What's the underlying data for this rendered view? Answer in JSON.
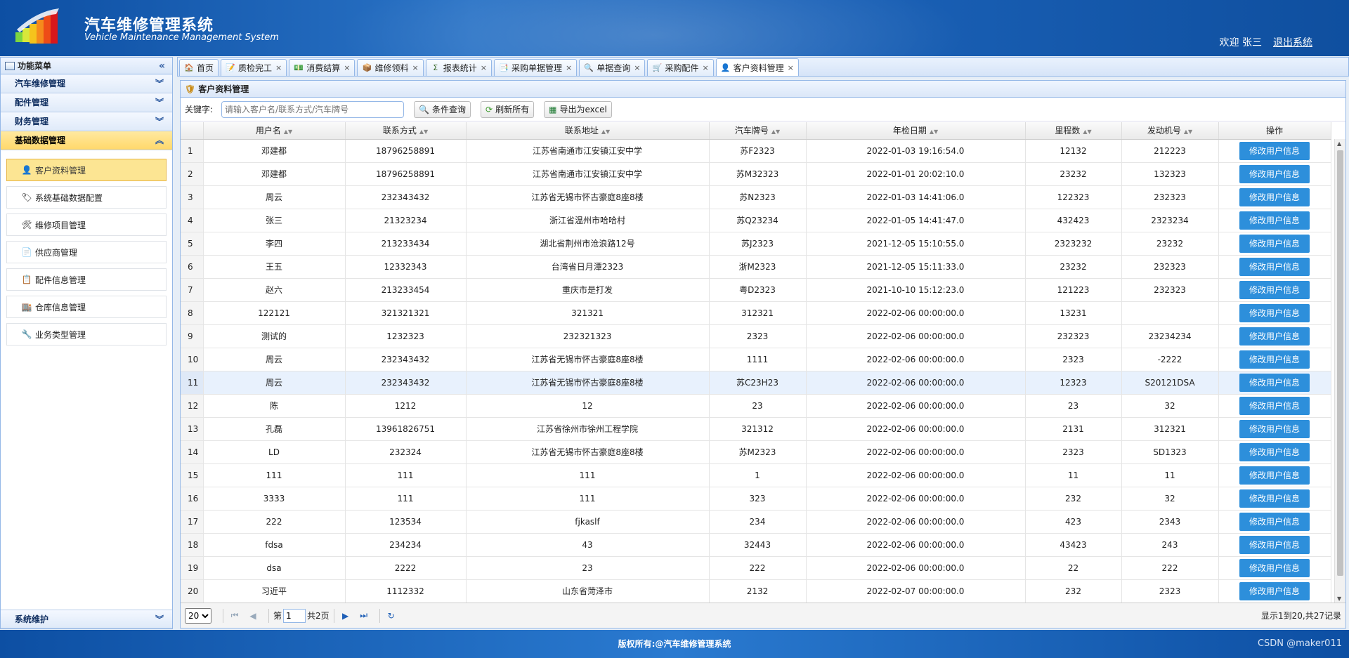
{
  "header": {
    "title": "汽车维修管理系统",
    "subtitle": "Vehicle Maintenance Management System",
    "welcome": "欢迎 张三",
    "logout": "退出系统"
  },
  "sidebar": {
    "title": "功能菜单",
    "sections": [
      {
        "label": "汽车维修管理"
      },
      {
        "label": "配件管理"
      },
      {
        "label": "财务管理"
      },
      {
        "label": "基础数据管理"
      }
    ],
    "items": [
      {
        "label": "客户资料管理",
        "icon": "user-icon"
      },
      {
        "label": "系统基础数据配置",
        "icon": "tag-icon"
      },
      {
        "label": "维修项目管理",
        "icon": "repair-icon"
      },
      {
        "label": "供应商管理",
        "icon": "document-icon"
      },
      {
        "label": "配件信息管理",
        "icon": "parts-icon"
      },
      {
        "label": "仓库信息管理",
        "icon": "warehouse-icon"
      },
      {
        "label": "业务类型管理",
        "icon": "wrench-icon"
      }
    ],
    "bottom_section": "系统维护"
  },
  "tabs": [
    {
      "label": "首页"
    },
    {
      "label": "质检完工"
    },
    {
      "label": "消费结算"
    },
    {
      "label": "维修领料"
    },
    {
      "label": "报表统计"
    },
    {
      "label": "采购单据管理"
    },
    {
      "label": "单据查询"
    },
    {
      "label": "采购配件"
    },
    {
      "label": "客户资料管理"
    }
  ],
  "panel": {
    "title": "客户资料管理",
    "keyword_label": "关键字:",
    "search_placeholder": "请输入客户名/联系方式/汽车牌号",
    "btn_query": "条件查询",
    "btn_refresh": "刷新所有",
    "btn_export": "导出为excel"
  },
  "table": {
    "columns": [
      "用户名",
      "联系方式",
      "联系地址",
      "汽车牌号",
      "年检日期",
      "里程数",
      "发动机号",
      "操作"
    ],
    "action_label": "修改用户信息",
    "rows": [
      [
        "1",
        "邓建都",
        "18796258891",
        "江苏省南通市江安镇江安中学",
        "苏F2323",
        "2022-01-03 19:16:54.0",
        "12132",
        "212223"
      ],
      [
        "2",
        "邓建都",
        "18796258891",
        "江苏省南通市江安镇江安中学",
        "苏M32323",
        "2022-01-01 20:02:10.0",
        "23232",
        "132323"
      ],
      [
        "3",
        "周云",
        "232343432",
        "江苏省无锡市怀古豪庭8座8楼",
        "苏N2323",
        "2022-01-03 14:41:06.0",
        "122323",
        "232323"
      ],
      [
        "4",
        "张三",
        "21323234",
        "浙江省温州市哈哈村",
        "苏Q23234",
        "2022-01-05 14:41:47.0",
        "432423",
        "2323234"
      ],
      [
        "5",
        "李四",
        "213233434",
        "湖北省荆州市沧浪路12号",
        "苏J2323",
        "2021-12-05 15:10:55.0",
        "2323232",
        "23232"
      ],
      [
        "6",
        "王五",
        "12332343",
        "台湾省日月潭2323",
        "浙M2323",
        "2021-12-05 15:11:33.0",
        "23232",
        "232323"
      ],
      [
        "7",
        "赵六",
        "213233454",
        "重庆市是打发",
        "粤D2323",
        "2021-10-10 15:12:23.0",
        "121223",
        "232323"
      ],
      [
        "8",
        "122121",
        "321321321",
        "321321",
        "312321",
        "2022-02-06 00:00:00.0",
        "13231",
        ""
      ],
      [
        "9",
        "测试的",
        "1232323",
        "232321323",
        "2323",
        "2022-02-06 00:00:00.0",
        "232323",
        "23234234"
      ],
      [
        "10",
        "周云",
        "232343432",
        "江苏省无锡市怀古豪庭8座8楼",
        "1111",
        "2022-02-06 00:00:00.0",
        "2323",
        "-2222"
      ],
      [
        "11",
        "周云",
        "232343432",
        "江苏省无锡市怀古豪庭8座8楼",
        "苏C23H23",
        "2022-02-06 00:00:00.0",
        "12323",
        "S20121DSA"
      ],
      [
        "12",
        "陈",
        "1212",
        "12",
        "23",
        "2022-02-06 00:00:00.0",
        "23",
        "32"
      ],
      [
        "13",
        "孔磊",
        "13961826751",
        "江苏省徐州市徐州工程学院",
        "321312",
        "2022-02-06 00:00:00.0",
        "2131",
        "312321"
      ],
      [
        "14",
        "LD",
        "232324",
        "江苏省无锡市怀古豪庭8座8楼",
        "苏M2323",
        "2022-02-06 00:00:00.0",
        "2323",
        "SD1323"
      ],
      [
        "15",
        "111",
        "111",
        "111",
        "1",
        "2022-02-06 00:00:00.0",
        "11",
        "11"
      ],
      [
        "16",
        "3333",
        "111",
        "111",
        "323",
        "2022-02-06 00:00:00.0",
        "232",
        "32"
      ],
      [
        "17",
        "222",
        "123534",
        "fjkaslf",
        "234",
        "2022-02-06 00:00:00.0",
        "423",
        "2343"
      ],
      [
        "18",
        "fdsa",
        "234234",
        "43",
        "32443",
        "2022-02-06 00:00:00.0",
        "43423",
        "243"
      ],
      [
        "19",
        "dsa",
        "2222",
        "23",
        "222",
        "2022-02-06 00:00:00.0",
        "22",
        "222"
      ],
      [
        "20",
        "习近平",
        "1112332",
        "山东省菏泽市",
        "2132",
        "2022-02-07 00:00:00.0",
        "232",
        "2323"
      ]
    ]
  },
  "pager": {
    "page_size": "20",
    "page_label": "第",
    "page_value": "1",
    "total_pages": "共2页",
    "info": "显示1到20,共27记录"
  },
  "footer": {
    "copyright": "版权所有:@汽车维修管理系统",
    "watermark": "CSDN @maker011"
  }
}
